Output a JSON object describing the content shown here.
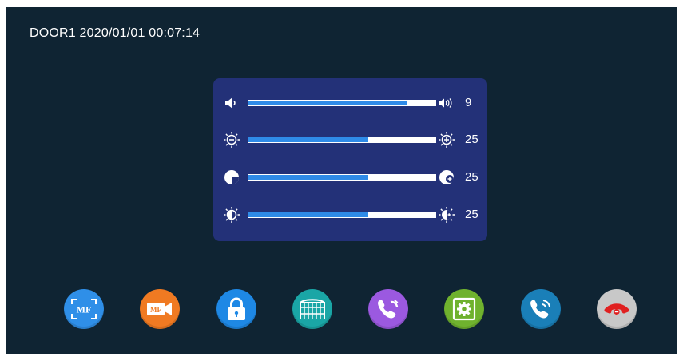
{
  "header": {
    "text": "DOOR1 2020/01/01 00:07:14"
  },
  "sliders": [
    {
      "name": "volume",
      "left_icon": "speaker-low-icon",
      "right_icon": "speaker-high-icon",
      "value": "9",
      "fill_percent": 85
    },
    {
      "name": "brightness",
      "left_icon": "brightness-minus-icon",
      "right_icon": "brightness-plus-icon",
      "value": "25",
      "fill_percent": 64
    },
    {
      "name": "color",
      "left_icon": "color-minus-icon",
      "right_icon": "color-plus-icon",
      "value": "25",
      "fill_percent": 64
    },
    {
      "name": "contrast",
      "left_icon": "contrast-low-icon",
      "right_icon": "contrast-high-icon",
      "value": "25",
      "fill_percent": 64
    }
  ],
  "buttons": [
    {
      "name": "snapshot-mf-button",
      "icon": "mf-scan-icon",
      "color": "#2f8fe8"
    },
    {
      "name": "record-mf-button",
      "icon": "mf-video-icon",
      "color": "#f07a22"
    },
    {
      "name": "unlock-button",
      "icon": "lock-icon",
      "color": "#1e88e5"
    },
    {
      "name": "gate-button",
      "icon": "gate-icon",
      "color": "#1aa6a6"
    },
    {
      "name": "transfer-call-button",
      "icon": "phone-transfer-icon",
      "color": "#9b59e0"
    },
    {
      "name": "settings-button",
      "icon": "settings-icon",
      "color": "#6fb22e"
    },
    {
      "name": "call-button",
      "icon": "phone-call-icon",
      "color": "#1a7fb8"
    },
    {
      "name": "hangup-button",
      "icon": "hangup-icon",
      "color": "#c8c8c8"
    }
  ]
}
